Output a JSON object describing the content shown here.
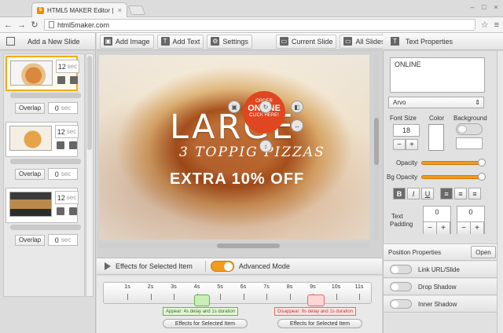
{
  "browser": {
    "tab_title": "HTML5 MAKER Editor | html",
    "favicon_letter": "5",
    "url": "html5maker.com"
  },
  "left_panel": {
    "title": "Add a New Slide",
    "slides": [
      {
        "duration": "12",
        "unit": "sec",
        "selected": true
      },
      {
        "duration": "12",
        "unit": "sec",
        "selected": false
      },
      {
        "duration": "12",
        "unit": "sec",
        "selected": false
      }
    ],
    "overlaps": [
      {
        "label": "Overlap",
        "value": "0",
        "unit": "sec"
      },
      {
        "label": "Overlap",
        "value": "0",
        "unit": "sec"
      },
      {
        "label": "Overlap",
        "value": "0",
        "unit": "sec"
      }
    ]
  },
  "toolbar": {
    "add_image": "Add Image",
    "add_text": "Add Text",
    "settings": "Settings",
    "current_slide": "Current Slide",
    "all_slides": "All Slides"
  },
  "canvas": {
    "badge_line1": "ORDER",
    "badge_line2": "ONLINE",
    "badge_line3": "CLICK HERE!",
    "headline": "LARGE",
    "subline": "3 TOPPIG PIZZAS",
    "offer": "EXTRA 10% OFF"
  },
  "timeline": {
    "effects_label": "Effects for Selected Item",
    "advanced_mode": "Advanced Mode",
    "advanced_mode_on": true,
    "ticks": [
      "1s",
      "2s",
      "3s",
      "4s",
      "5s",
      "6s",
      "7s",
      "8s",
      "9s",
      "10s",
      "11s"
    ],
    "appear_note": "Appear: 4s delay and 1s duration",
    "disappear_note": "Disappear: 9s delay and 1s duration",
    "effects_button_1": "Effects for Selected Item",
    "effects_button_2": "Effects for Selected Item"
  },
  "properties": {
    "title": "Text Properties",
    "text_value": "ONLINE",
    "font": "Arvo",
    "font_size_label": "Font Size",
    "font_size": "18",
    "color_label": "Color",
    "background_label": "Background",
    "opacity_label": "Opacity",
    "bg_opacity_label": "Bg Opacity",
    "opacity": 1.0,
    "bg_opacity": 1.0,
    "bold": "B",
    "italic": "I",
    "underline": "U",
    "text_padding_label_1": "Text",
    "text_padding_label_2": "Padding",
    "padding_x": "0",
    "padding_y": "0",
    "position_properties": "Position Properties",
    "open_button": "Open",
    "link_url": "Link URL/Slide",
    "drop_shadow": "Drop Shadow",
    "inner_shadow": "Inner Shadow",
    "minus": "−",
    "plus": "+"
  },
  "colors": {
    "accent": "#f29b1c",
    "badge": "#e0461f",
    "appear": "#6ab04c",
    "disappear": "#e06c6c"
  }
}
